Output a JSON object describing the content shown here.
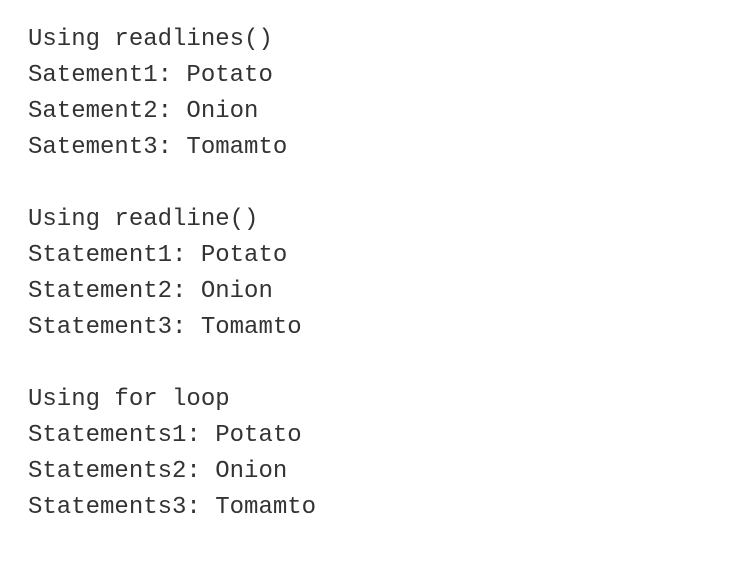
{
  "blocks": [
    {
      "header": "Using readlines()",
      "lines": [
        "Satement1: Potato",
        "Satement2: Onion",
        "Satement3: Tomamto"
      ]
    },
    {
      "header": "Using readline()",
      "lines": [
        "Statement1: Potato",
        "Statement2: Onion",
        "Statement3: Tomamto"
      ]
    },
    {
      "header": "Using for loop",
      "lines": [
        "Statements1: Potato",
        "Statements2: Onion",
        "Statements3: Tomamto"
      ]
    }
  ]
}
